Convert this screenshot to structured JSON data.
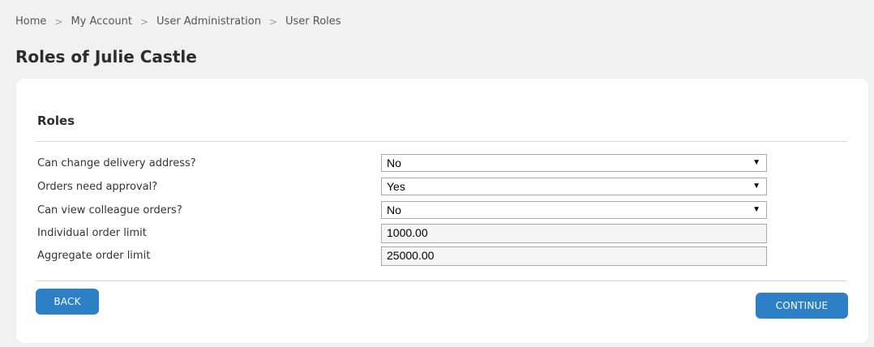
{
  "breadcrumb": {
    "items": [
      "Home",
      "My Account",
      "User Administration",
      "User Roles"
    ],
    "separator": ">"
  },
  "page": {
    "title": "Roles of Julie Castle"
  },
  "roles": {
    "section_title": "Roles",
    "fields": [
      {
        "label": "Can change delivery address?",
        "type": "select",
        "value": "No"
      },
      {
        "label": "Orders need approval?",
        "type": "select",
        "value": "Yes"
      },
      {
        "label": "Can view colleague orders?",
        "type": "select",
        "value": "No"
      },
      {
        "label": "Individual order limit",
        "type": "text",
        "value": "1000.00"
      },
      {
        "label": "Aggregate order limit",
        "type": "text",
        "value": "25000.00"
      }
    ]
  },
  "actions": {
    "back_label": "BACK",
    "continue_label": "CONTINUE"
  },
  "colors": {
    "page_background": "#f1f1f1",
    "card_background": "#ffffff",
    "button": "#2e80c6",
    "button_text": "#ffffff"
  },
  "icons": {
    "select_arrow": "triangle-down-icon",
    "breadcrumb_separator": "chevron-right-icon"
  }
}
